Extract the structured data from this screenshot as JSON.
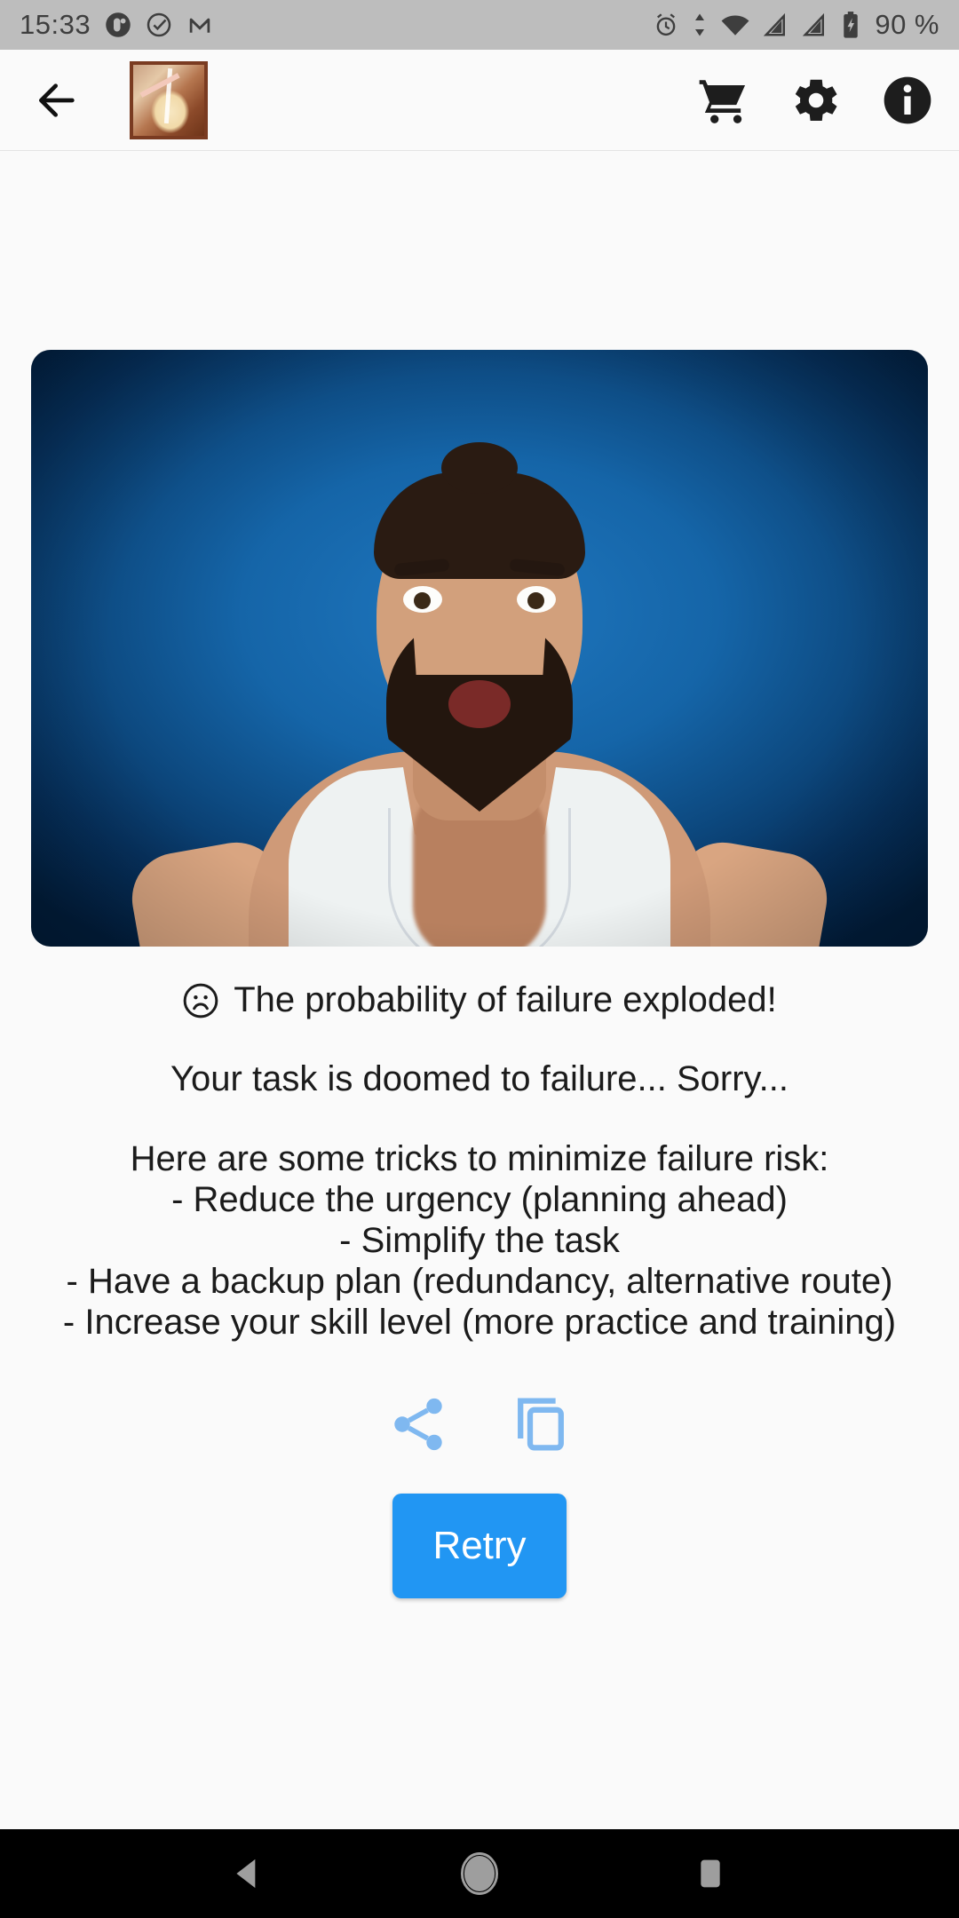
{
  "status_bar": {
    "time": "15:33",
    "battery_percent": "90 %",
    "left_icons": [
      "app-circle-icon",
      "check-circle-icon",
      "gmail-icon"
    ],
    "right_icons": [
      "alarm-icon",
      "data-transfer-icon",
      "wifi-icon",
      "signal-1-icon",
      "signal-2-icon",
      "battery-charging-icon"
    ],
    "background_color": "#bdbdbd"
  },
  "app_bar": {
    "back_label": "Back",
    "logo_label": "App logo",
    "actions": [
      {
        "name": "cart-icon",
        "label": "Shop"
      },
      {
        "name": "gear-icon",
        "label": "Settings"
      },
      {
        "name": "info-icon",
        "label": "Info"
      }
    ]
  },
  "result": {
    "hero_alt": "Surprised man in white tank top on blue background",
    "headline": "The probability of failure exploded!",
    "headline_emoji": "sad-face-icon",
    "subtext": "Your task is doomed to failure... Sorry...",
    "tips_title": "Here are some tricks to minimize failure risk:",
    "tips": [
      "- Reduce the urgency (planning ahead)",
      "- Simplify the task",
      "- Have a backup plan (redundancy, alternative route)",
      "- Increase your skill level (more practice and training)"
    ],
    "share_label": "Share",
    "copy_label": "Copy",
    "retry_label": "Retry",
    "accent_color": "#2196f3",
    "icon_tint": "#7fb8f0"
  },
  "nav_bar": {
    "back": "back-triangle-icon",
    "home": "home-circle-icon",
    "recents": "recents-square-icon",
    "background_color": "#000000"
  }
}
